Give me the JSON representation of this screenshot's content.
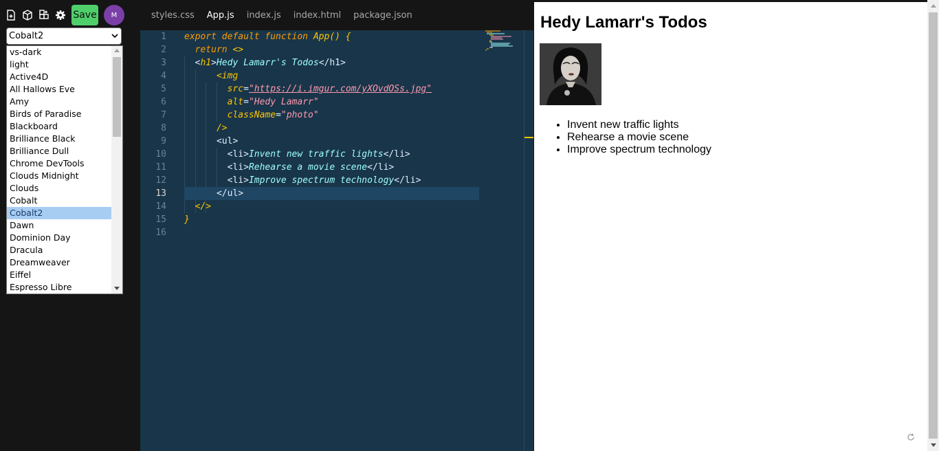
{
  "toolbar": {
    "icons": [
      "new-file-icon",
      "package-icon",
      "add-block-icon",
      "gear-icon"
    ],
    "save_label": "Save",
    "avatar_initial": "M",
    "save_color": "#4fcf6a",
    "avatar_color": "#7b3fa8"
  },
  "theme_select": {
    "value": "Cobalt2",
    "options": [
      "vs-dark",
      "light",
      "Active4D",
      "All Hallows Eve",
      "Amy",
      "Birds of Paradise",
      "Blackboard",
      "Brilliance Black",
      "Brilliance Dull",
      "Chrome DevTools",
      "Clouds Midnight",
      "Clouds",
      "Cobalt",
      "Cobalt2",
      "Dawn",
      "Dominion Day",
      "Dracula",
      "Dreamweaver",
      "Eiffel",
      "Espresso Libre"
    ],
    "selected_index": 13
  },
  "tabs": [
    {
      "label": "styles.css",
      "active": false
    },
    {
      "label": "App.js",
      "active": true
    },
    {
      "label": "index.js",
      "active": false
    },
    {
      "label": "index.html",
      "active": false
    },
    {
      "label": "package.json",
      "active": false
    }
  ],
  "editor": {
    "current_line": 13,
    "line_numbers": [
      "1",
      "2",
      "3",
      "4",
      "5",
      "6",
      "7",
      "8",
      "9",
      "10",
      "11",
      "12",
      "13",
      "14",
      "15",
      "16"
    ],
    "code": {
      "l1_export": "export default function",
      "l1_app": "App",
      "l1_rest": "() {",
      "l2_return": "return",
      "l2_frag": "<>",
      "l3_open": "<",
      "l3_tag": "h1",
      "l3_gt": ">",
      "l3_text": "Hedy Lamarr's Todos",
      "l3_close": "</h1>",
      "l4_img": "<img",
      "l5_attr": "src",
      "l5_val": "\"https://i.imgur.com/yXOvdOSs.jpg\"",
      "l6_attr": "alt",
      "l6_val": "\"Hedy Lamarr\"",
      "l7_attr": "className",
      "l7_val": "\"photo\"",
      "l8": "/>",
      "l9": "<ul>",
      "l10_text": "Invent new traffic lights",
      "l11_text": "Rehearse a movie scene",
      "l12_text": "Improve spectrum technology",
      "li_open": "<li>",
      "li_close": "</li>",
      "l13": "</ul>",
      "l14": "</>",
      "l15": "}"
    }
  },
  "preview": {
    "heading": "Hedy Lamarr's Todos",
    "image_alt": "Hedy Lamarr",
    "items": [
      "Invent new traffic lights",
      "Rehearse a movie scene",
      "Improve spectrum technology"
    ]
  }
}
